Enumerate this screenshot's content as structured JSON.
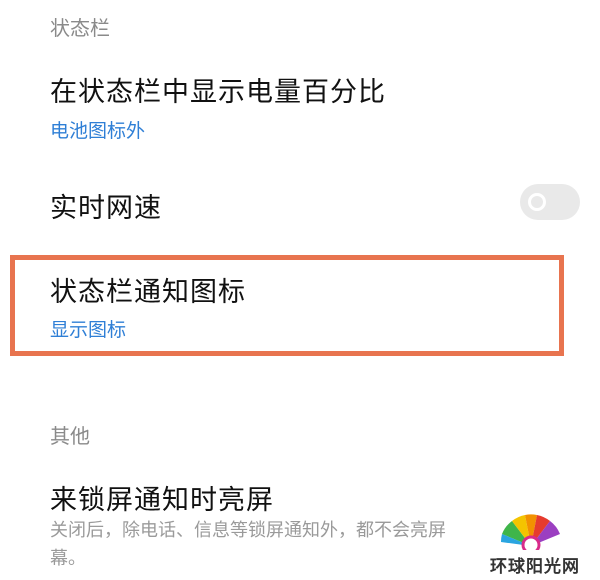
{
  "sections": {
    "status_bar_header": "状态栏",
    "other_header": "其他"
  },
  "items": {
    "battery_percent": {
      "title": "在状态栏中显示电量百分比",
      "value": "电池图标外"
    },
    "realtime_speed": {
      "title": "实时网速",
      "toggle_state": "off"
    },
    "notification_icons": {
      "title": "状态栏通知图标",
      "value": "显示图标"
    },
    "wake_on_notification": {
      "title": "来锁屏通知时亮屏",
      "description": "关闭后，除电话、信息等锁屏通知外，都不会亮屏幕。"
    }
  },
  "watermark": {
    "text": "环球阳光网"
  },
  "colors": {
    "accent_blue": "#2f7fd6",
    "highlight_border": "#e8744f",
    "toggle_off": "#e9e9e9"
  }
}
